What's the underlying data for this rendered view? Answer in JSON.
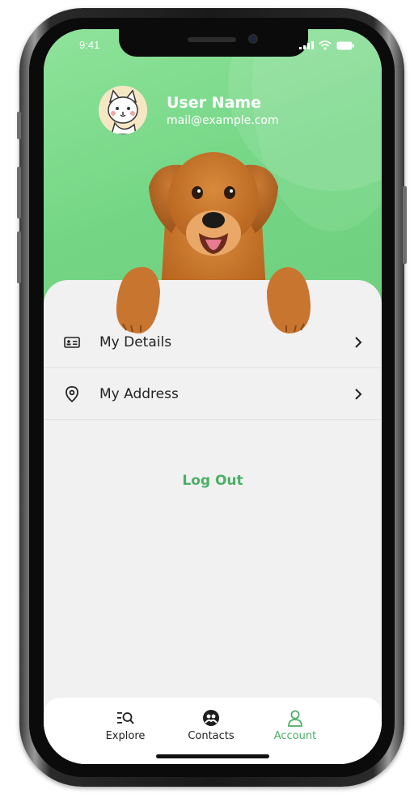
{
  "status_bar": {
    "time": "9:41"
  },
  "profile": {
    "name": "User Name",
    "email": "mail@example.com"
  },
  "menu": [
    {
      "label": "My Details",
      "icon": "id-card-icon"
    },
    {
      "label": "My Address",
      "icon": "location-pin-icon"
    }
  ],
  "logout_label": "Log Out",
  "tabs": [
    {
      "label": "Explore",
      "icon": "explore-icon",
      "active": false
    },
    {
      "label": "Contacts",
      "icon": "contacts-icon",
      "active": false
    },
    {
      "label": "Account",
      "icon": "account-icon",
      "active": true
    }
  ],
  "colors": {
    "header_green": "#74d685",
    "accent_green": "#4caf65",
    "background": "#f1f1f1"
  }
}
